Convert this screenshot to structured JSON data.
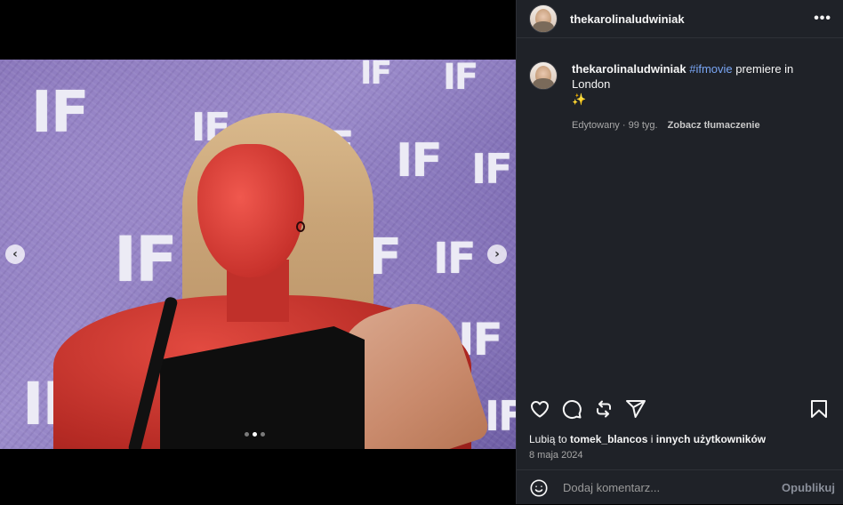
{
  "post": {
    "username": "thekarolinaludwiniak",
    "caption": {
      "username": "thekarolinaludwiniak",
      "hashtag": "#ifmovie",
      "text": " premiere in London ",
      "emoji": "✨"
    },
    "meta": {
      "edited": "Edytowany · 99 tyg.",
      "see_translation": "Zobacz tłumaczenie"
    },
    "likes": {
      "prefix": "Lubią to ",
      "user": "tomek_blancos",
      "middle": " i ",
      "suffix": "innych użytkowników"
    },
    "date": "8 maja 2024"
  },
  "media": {
    "backdrop_text": "IF",
    "carousel_count": 3,
    "carousel_active": 2
  },
  "comment": {
    "placeholder": "Dodaj komentarz...",
    "publish_label": "Opublikuj"
  },
  "icons": {
    "more": "more-options-icon",
    "like": "heart-icon",
    "comment": "comment-icon",
    "repost": "repost-icon",
    "share": "send-icon",
    "save": "bookmark-icon",
    "emoji": "emoji-icon",
    "prev": "chevron-left-icon",
    "next": "chevron-right-icon"
  },
  "colors": {
    "panel_bg": "#1f2228",
    "hashtag": "#7aa7f6",
    "backdrop": "#8673b8"
  }
}
